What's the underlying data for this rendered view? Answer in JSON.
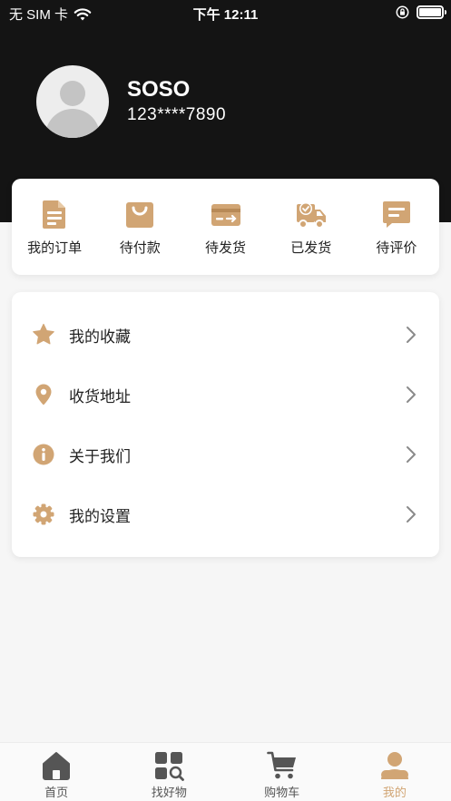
{
  "status_bar": {
    "carrier": "无 SIM 卡",
    "time": "下午 12:11"
  },
  "profile": {
    "name": "SOSO",
    "phone": "123****7890"
  },
  "orders": [
    {
      "label": "我的订单",
      "icon": "document-icon"
    },
    {
      "label": "待付款",
      "icon": "shopping-bag-icon"
    },
    {
      "label": "待发货",
      "icon": "card-send-icon"
    },
    {
      "label": "已发货",
      "icon": "delivery-truck-icon"
    },
    {
      "label": "待评价",
      "icon": "comment-icon"
    }
  ],
  "menu": [
    {
      "label": "我的收藏",
      "icon": "star-icon"
    },
    {
      "label": "收货地址",
      "icon": "location-pin-icon"
    },
    {
      "label": "关于我们",
      "icon": "info-icon"
    },
    {
      "label": "我的设置",
      "icon": "gear-icon"
    }
  ],
  "tabs": [
    {
      "label": "首页",
      "icon": "home-icon",
      "active": false
    },
    {
      "label": "找好物",
      "icon": "grid-search-icon",
      "active": false
    },
    {
      "label": "购物车",
      "icon": "cart-icon",
      "active": false
    },
    {
      "label": "我的",
      "icon": "user-icon",
      "active": true
    }
  ],
  "colors": {
    "accent": "#D1A574",
    "header_bg": "#141414",
    "tab_inactive": "#555555"
  }
}
